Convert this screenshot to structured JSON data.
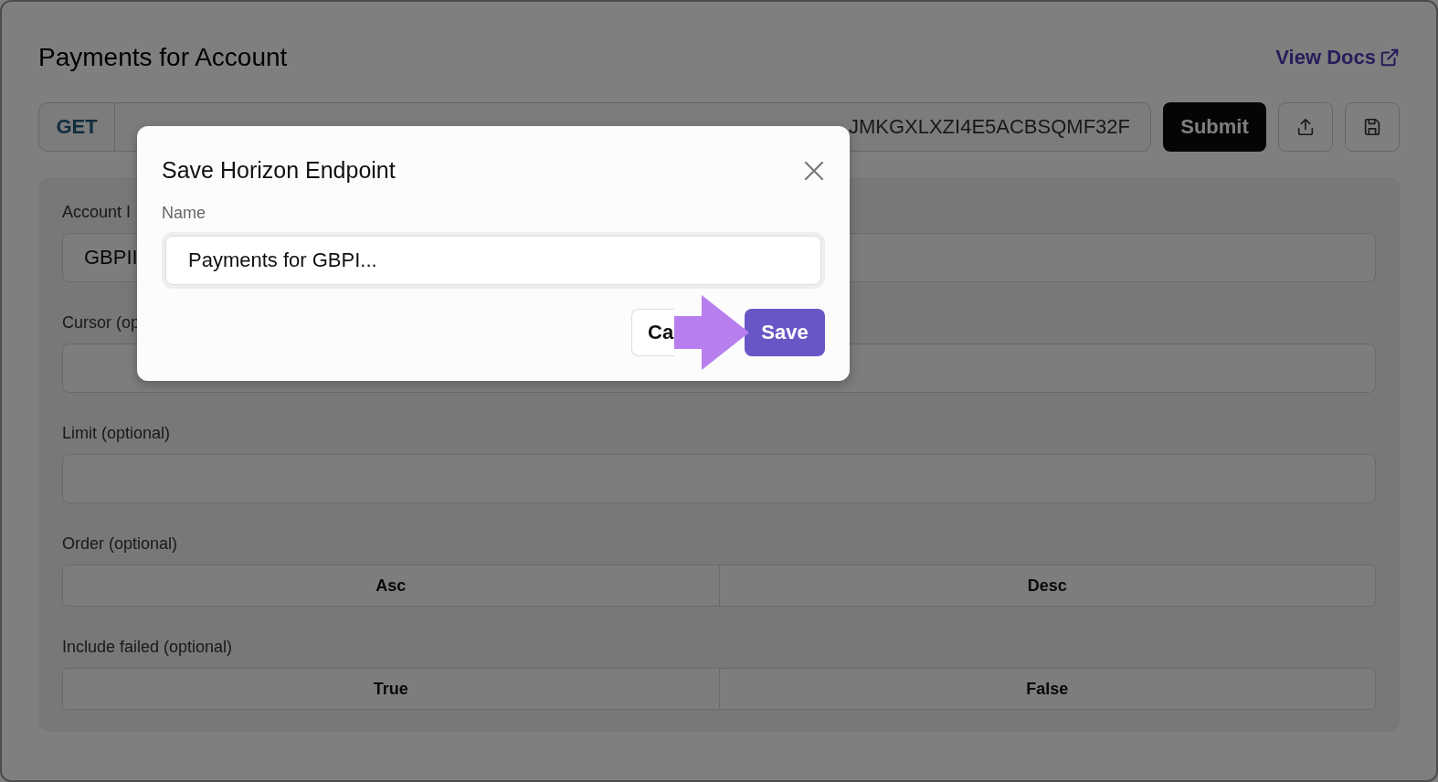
{
  "page": {
    "title": "Payments for Account",
    "docs_link": "View Docs"
  },
  "request": {
    "method": "GET",
    "url_visible": "JMKGXLXZI4E5ACBSQMF32F",
    "submit": "Submit"
  },
  "form": {
    "fields": [
      {
        "kind": "input",
        "label": "Account I",
        "value": "GBPII"
      },
      {
        "kind": "input",
        "label": "Cursor (op"
      },
      {
        "kind": "input",
        "label": "Limit (optional)"
      },
      {
        "kind": "toggle",
        "label": "Order (optional)",
        "options": [
          {
            "label": "Asc",
            "selected": false
          },
          {
            "label": "Desc",
            "selected": false
          }
        ]
      },
      {
        "kind": "toggle",
        "label": "Include failed (optional)",
        "options": [
          {
            "label": "True",
            "selected": false
          },
          {
            "label": "False",
            "selected": false
          }
        ]
      }
    ]
  },
  "dialog": {
    "title": "Save Horizon Endpoint",
    "field_label": "Name",
    "value": "Payments for GBPI...",
    "cancel": "Ca",
    "save": "Save"
  }
}
